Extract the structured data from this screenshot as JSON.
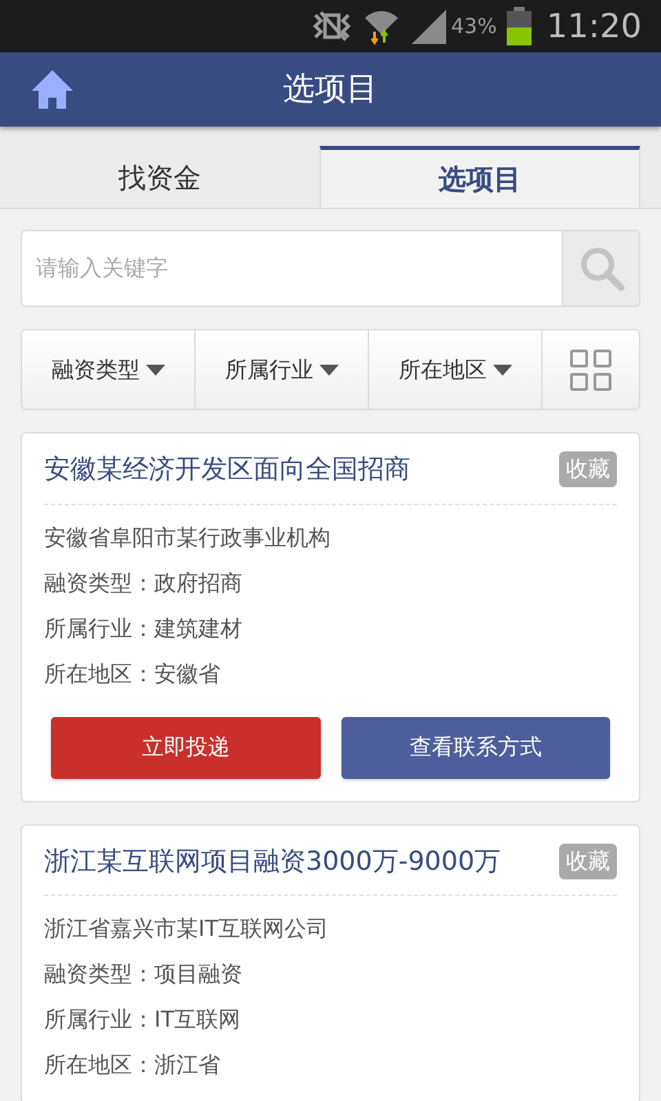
{
  "status_bar": {
    "battery": "43%",
    "time": "11:20"
  },
  "header": {
    "title": "选项目"
  },
  "tabs": [
    {
      "label": "找资金",
      "selected": false
    },
    {
      "label": "选项目",
      "selected": true
    }
  ],
  "search": {
    "placeholder": "请输入关键字"
  },
  "filters": [
    "融资类型",
    "所属行业",
    "所在地区"
  ],
  "projects": [
    {
      "title": "安徽某经济开发区面向全国招商",
      "favorite": "收藏",
      "lines": [
        "安徽省阜阳市某行政事业机构",
        "融资类型：政府招商",
        "所属行业：建筑建材",
        "所在地区：安徽省"
      ],
      "buttons": [
        "立即投递",
        "查看联系方式"
      ]
    },
    {
      "title": "浙江某互联网项目融资3000万-9000万",
      "favorite": "收藏",
      "lines": [
        "浙江省嘉兴市某IT互联网公司",
        "融资类型：项目融资",
        "所属行业：IT互联网",
        "所在地区：浙江省"
      ]
    }
  ]
}
